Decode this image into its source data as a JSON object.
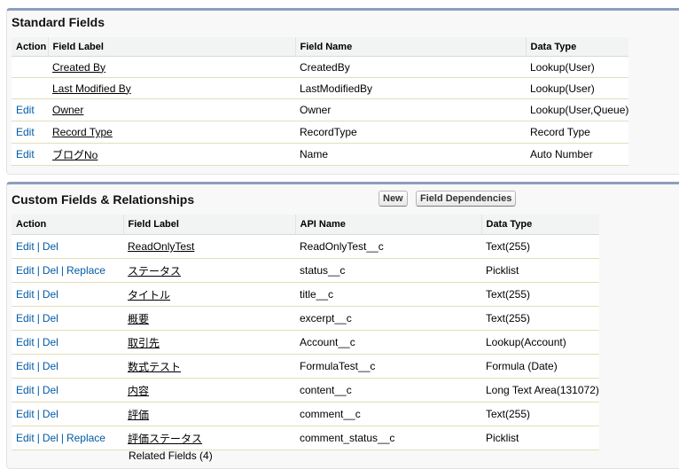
{
  "standard_fields": {
    "title": "Standard Fields",
    "columns": [
      "Action",
      "Field Label",
      "Field Name",
      "Data Type"
    ],
    "rows": [
      {
        "action": "",
        "label": "Created By",
        "name": "CreatedBy",
        "type": "Lookup(User)"
      },
      {
        "action": "",
        "label": "Last Modified By",
        "name": "LastModifiedBy",
        "type": "Lookup(User)"
      },
      {
        "action": "Edit",
        "label": "Owner",
        "name": "Owner",
        "type": "Lookup(User,Queue)"
      },
      {
        "action": "Edit",
        "label": "Record Type",
        "name": "RecordType",
        "type": "Record Type"
      },
      {
        "action": "Edit",
        "label": "ブログNo",
        "name": "Name",
        "type": "Auto Number"
      }
    ]
  },
  "custom_fields": {
    "title": "Custom Fields & Relationships",
    "new_button": "New",
    "dependencies_button": "Field Dependencies",
    "columns": [
      "Action",
      "Field Label",
      "API Name",
      "Data Type"
    ],
    "edit_label": "Edit",
    "del_label": "Del",
    "replace_label": "Replace",
    "separator": "|",
    "rows": [
      {
        "label": "ReadOnlyTest",
        "api": "ReadOnlyTest__c",
        "type": "Text(255)"
      },
      {
        "label": "ステータス",
        "api": "status__c",
        "type": "Picklist"
      },
      {
        "label": "タイトル",
        "api": "title__c",
        "type": "Text(255)"
      },
      {
        "label": "概要",
        "api": "excerpt__c",
        "type": "Text(255)"
      },
      {
        "label": "取引先",
        "api": "Account__c",
        "type": "Lookup(Account)"
      },
      {
        "label": "数式テスト",
        "api": "FormulaTest__c",
        "type": "Formula (Date)"
      },
      {
        "label": "内容",
        "api": "content__c",
        "type": "Long Text Area(131072)"
      },
      {
        "label": "評価",
        "api": "comment__c",
        "type": "Text(255)"
      },
      {
        "label": "評価ステータス",
        "api": "comment_status__c",
        "type": "Picklist"
      }
    ]
  },
  "related_fields_partial": "Related Fields (4)"
}
